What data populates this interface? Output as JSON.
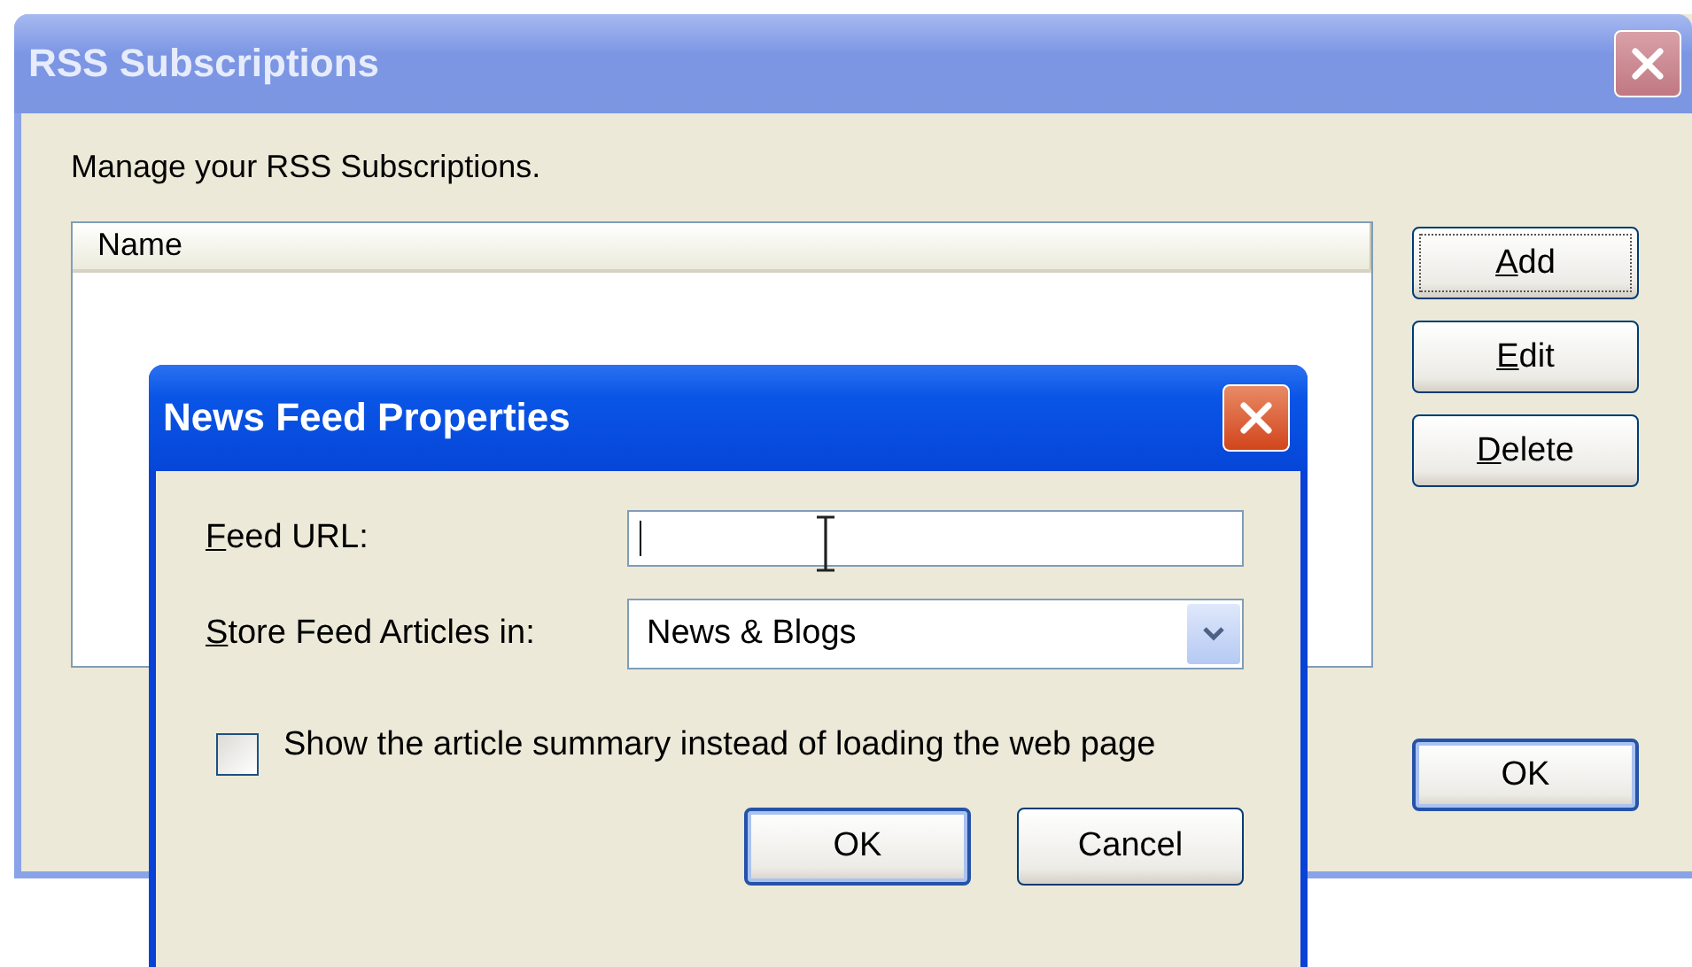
{
  "window": {
    "title": "RSS Subscriptions",
    "active": false
  },
  "intro": "Manage your RSS Subscriptions.",
  "list": {
    "columns": [
      "Name"
    ]
  },
  "side_buttons": [
    {
      "hotkey": "A",
      "rest": "dd",
      "focused": true,
      "default": false
    },
    {
      "hotkey": "E",
      "rest": "dit",
      "focused": false,
      "default": false
    },
    {
      "hotkey": "D",
      "rest": "elete",
      "focused": false,
      "default": false
    }
  ],
  "ok_button": {
    "label": "OK",
    "default": true
  },
  "dialog": {
    "title": "News Feed Properties",
    "active": true,
    "url_field": {
      "hotkey": "F",
      "rest": "eed URL:",
      "focused": true
    },
    "store_field": {
      "hotkey": "S",
      "rest": "tore Feed Articles in:",
      "value": "News & Blogs"
    },
    "summary_checkbox": {
      "label": "Show the article summary instead of loading the web page",
      "checked": false
    },
    "buttons": [
      {
        "label": "OK",
        "default": true
      },
      {
        "label": "Cancel",
        "default": false
      }
    ]
  }
}
